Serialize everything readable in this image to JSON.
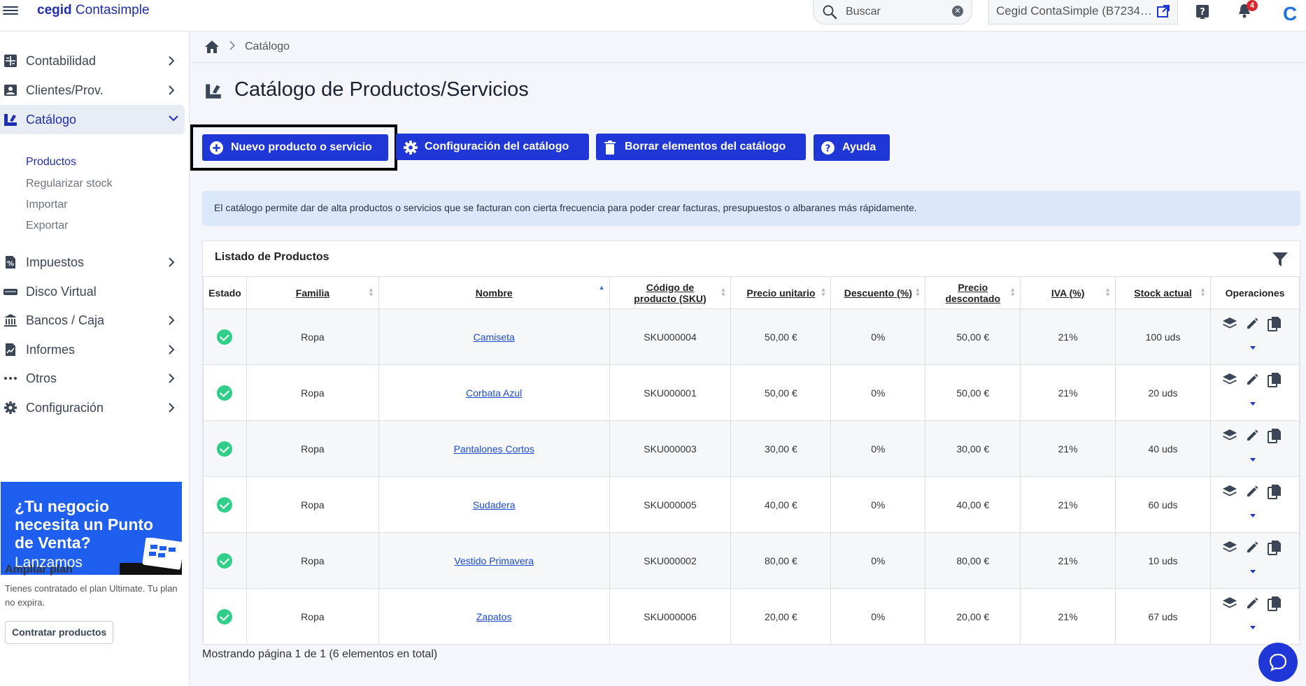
{
  "header": {
    "brand_bold": "cegid",
    "brand_rest": " Contasimple",
    "search_placeholder": "Buscar",
    "company": "Cegid ContaSimple (B7234…",
    "notifications": "4",
    "corner_logo": "C"
  },
  "sidebar": {
    "items": [
      {
        "label": "Contabilidad",
        "icon": "ledger-icon"
      },
      {
        "label": "Clientes/Prov.",
        "icon": "contact-card-icon"
      },
      {
        "label": "Catálogo",
        "icon": "catalog-icon"
      },
      {
        "label": "Impuestos",
        "icon": "tax-document-icon"
      },
      {
        "label": "Disco Virtual",
        "icon": "drive-icon"
      },
      {
        "label": "Bancos / Caja",
        "icon": "bank-icon"
      },
      {
        "label": "Informes",
        "icon": "report-icon"
      },
      {
        "label": "Otros",
        "icon": "more-dots-icon"
      },
      {
        "label": "Configuración",
        "icon": "gear-icon"
      }
    ],
    "submenu": [
      "Productos",
      "Regularizar stock",
      "Importar",
      "Exportar"
    ],
    "promo": {
      "headline": "¿Tu negocio necesita un Punto de Venta?",
      "sub": "Lanzamos"
    },
    "plan": {
      "title": "Ampliar plan",
      "text": "Tienes contratado el plan Ultimate. Tu plan no expira.",
      "button": "Contratar productos"
    }
  },
  "breadcrumb": {
    "current": "Catálogo"
  },
  "page": {
    "title": "Catálogo de Productos/Servicios",
    "buttons": {
      "new": "Nuevo producto o servicio",
      "config": "Configuración del catálogo",
      "delete": "Borrar elementos del catálogo",
      "help": "Ayuda"
    },
    "info": "El catálogo permite dar de alta productos o servicios que se facturan con cierta frecuencia para poder crear facturas, presupuestos o albaranes más rápidamente."
  },
  "table": {
    "title": "Listado de Productos",
    "headers": {
      "estado": "Estado",
      "familia": "Familia",
      "nombre": "Nombre",
      "sku": "Código de producto (SKU)",
      "precio": "Precio unitario",
      "descuento": "Descuento (%)",
      "descontado": "Precio descontado",
      "iva": "IVA (%)",
      "stock": "Stock actual",
      "operaciones": "Operaciones"
    },
    "rows": [
      {
        "familia": "Ropa",
        "nombre": "Camiseta",
        "sku": "SKU000004",
        "precio": "50,00 €",
        "descuento": "0%",
        "descontado": "50,00 €",
        "iva": "21%",
        "stock": "100 uds"
      },
      {
        "familia": "Ropa",
        "nombre": "Corbata Azul",
        "sku": "SKU000001",
        "precio": "50,00 €",
        "descuento": "0%",
        "descontado": "50,00 €",
        "iva": "21%",
        "stock": "20 uds"
      },
      {
        "familia": "Ropa",
        "nombre": "Pantalones Cortos",
        "sku": "SKU000003",
        "precio": "30,00 €",
        "descuento": "0%",
        "descontado": "30,00 €",
        "iva": "21%",
        "stock": "40 uds"
      },
      {
        "familia": "Ropa",
        "nombre": "Sudadera",
        "sku": "SKU000005",
        "precio": "40,00 €",
        "descuento": "0%",
        "descontado": "40,00 €",
        "iva": "21%",
        "stock": "60 uds"
      },
      {
        "familia": "Ropa",
        "nombre": "Vestido Primavera",
        "sku": "SKU000002",
        "precio": "80,00 €",
        "descuento": "0%",
        "descontado": "80,00 €",
        "iva": "21%",
        "stock": "10 uds"
      },
      {
        "familia": "Ropa",
        "nombre": "Zapatos",
        "sku": "SKU000006",
        "precio": "20,00 €",
        "descuento": "0%",
        "descontado": "20,00 €",
        "iva": "21%",
        "stock": "67 uds"
      }
    ],
    "pager": "Mostrando página 1 de 1 (6 elementos en total)"
  },
  "colors": {
    "primary": "#1f37d6",
    "brand": "#1f2db0",
    "success": "#2fcf8a",
    "info_bg": "#dbe7fb"
  }
}
